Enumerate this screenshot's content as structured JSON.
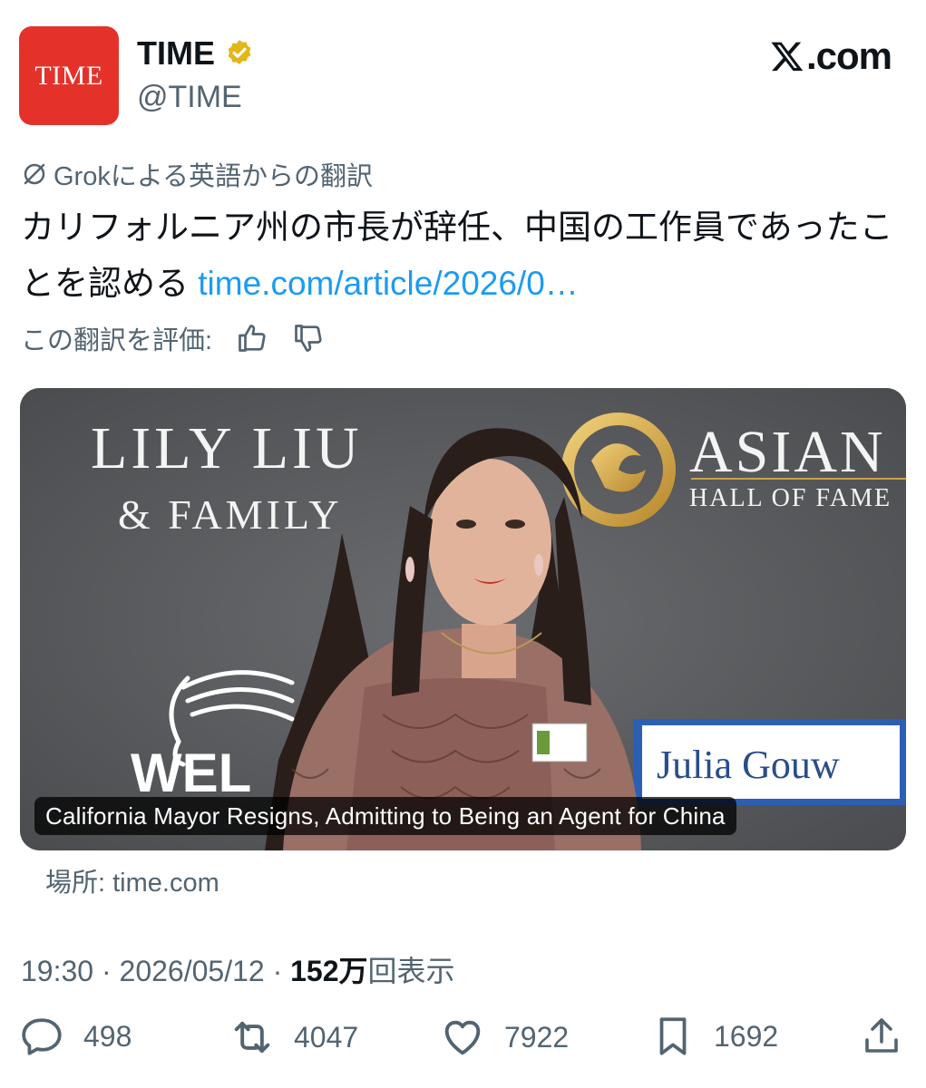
{
  "header": {
    "avatar_text": "TIME",
    "name": "TIME",
    "verified_icon": "verified-badge-icon",
    "handle": "@TIME",
    "site_label": ".com",
    "site_logo": "x-logo-icon"
  },
  "translation": {
    "source_label": "Grokによる英語からの翻訳",
    "text": "カリフォルニア州の市長が辞任、中国の工作員であったことを認める",
    "link": "time.com/article/2026/0…",
    "rate_label": "この翻訳を評価:"
  },
  "card": {
    "image_text": {
      "lily_line1": "LILY LIU",
      "lily_line2": "& FAMILY",
      "asian_line1": "ASIAN",
      "asian_line2": "HALL OF FAME",
      "wel": "WEL",
      "julia": "Julia Gouw"
    },
    "caption": "California Mayor Resigns, Admitting to Being an Agent for China",
    "source": "場所: time.com"
  },
  "meta": {
    "time": "19:30",
    "sep1": " · ",
    "date": "2026/05/12",
    "sep2": " · ",
    "views_count": "152万",
    "views_label": "回表示"
  },
  "actions": {
    "replies": "498",
    "reposts": "4047",
    "likes": "7922",
    "bookmarks": "1692"
  },
  "colors": {
    "link": "#1d9bf0",
    "muted": "#536471",
    "time_red": "#e4322b",
    "verified_gold": "#e2b719"
  }
}
